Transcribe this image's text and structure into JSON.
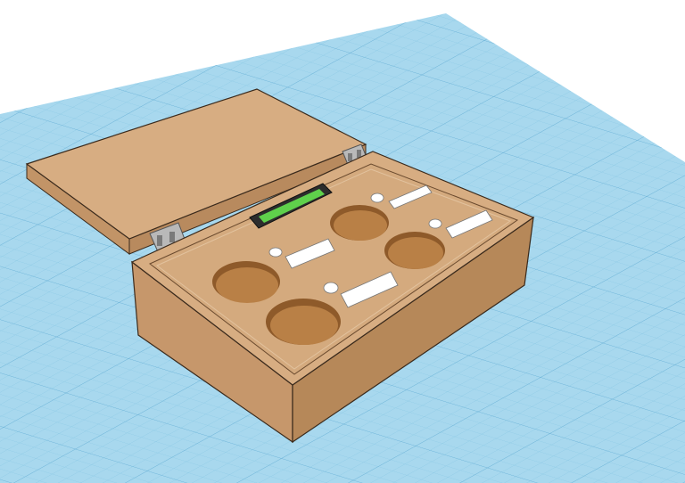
{
  "scene": {
    "background": "#ffffff",
    "grid_color": "#a8d8ee",
    "grid_line_color": "#7fc0e0",
    "wood_top": "#d7ad82",
    "wood_side": "#c29467",
    "wood_edge": "#3a2a1c",
    "hole_fill": "#b98046",
    "hole_dark": "#8e5a2a",
    "hinge_color": "#b9b9b9",
    "lcd_green": "#5fd14b",
    "lcd_frame": "#2d2d2d"
  },
  "objects": [
    {
      "name": "box-base",
      "label": ""
    },
    {
      "name": "box-lid",
      "label": ""
    },
    {
      "name": "lcd-display",
      "label": ""
    }
  ]
}
